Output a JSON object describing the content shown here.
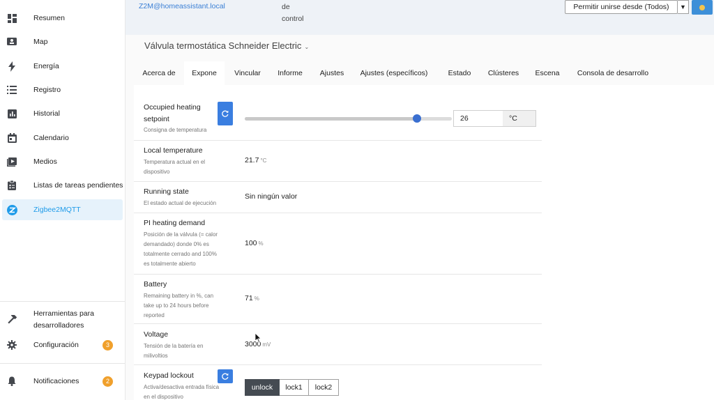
{
  "sidebar": {
    "items": [
      {
        "label": "Resumen",
        "icon": "dashboard-icon"
      },
      {
        "label": "Map",
        "icon": "map-icon"
      },
      {
        "label": "Energía",
        "icon": "lightning-icon"
      },
      {
        "label": "Registro",
        "icon": "list-icon"
      },
      {
        "label": "Historial",
        "icon": "chart-icon"
      },
      {
        "label": "Calendario",
        "icon": "calendar-icon"
      },
      {
        "label": "Medios",
        "icon": "media-icon"
      },
      {
        "label": "Listas de tareas pendientes",
        "icon": "clipboard-icon"
      },
      {
        "label": "Zigbee2MQTT",
        "icon": "zigbee-icon"
      }
    ],
    "bottom": [
      {
        "label1": "Herramientas para",
        "label2": "desarrolladores",
        "icon": "hammer-icon"
      },
      {
        "label": "Configuración",
        "icon": "gear-icon",
        "badge": "3"
      },
      {
        "label": "Notificaciones",
        "icon": "bell-icon",
        "badge": "2"
      }
    ]
  },
  "top": {
    "link": "Z2M@homeassistant.local",
    "ctrl1": "de",
    "ctrl2": "control",
    "permit_label": "Permitir unirse desde (Todos)"
  },
  "device": {
    "title": "Válvula termostática Schneider Electric"
  },
  "tabs": [
    "Acerca de",
    "Expone",
    "Vincular",
    "Informe",
    "Ajustes",
    "Ajustes (específicos)",
    "Estado",
    "Clústeres",
    "Escena",
    "Consola de desarrollo"
  ],
  "exposes": {
    "setpoint": {
      "title1": "Occupied heating",
      "title2": "setpoint",
      "desc": "Consigna de temperatura",
      "value": "26",
      "unit": "°C",
      "slider_fraction": 0.83
    },
    "local_temp": {
      "title": "Local temperature",
      "desc1": "Temperatura actual en el",
      "desc2": "dispositivo",
      "value": "21.7",
      "unit": "°C"
    },
    "running": {
      "title": "Running state",
      "desc": "El estado actual de ejecución",
      "value": "Sin ningún valor"
    },
    "pi_demand": {
      "title": "PI heating demand",
      "desc1": "Posición de la válvula (= calor",
      "desc2": "demandado) donde 0% es",
      "desc3": "totalmente cerrado and 100%",
      "desc4": "es totalmente abierto",
      "value": "100",
      "unit": "%"
    },
    "battery": {
      "title": "Battery",
      "desc1": "Remaining battery in %, can",
      "desc2": "take up to 24 hours before",
      "desc3": "reported",
      "value": "71",
      "unit": "%"
    },
    "voltage": {
      "title": "Voltage",
      "desc1": "Tensión de la batería en",
      "desc2": "milivoltios",
      "value": "3000",
      "unit": "mV"
    },
    "keypad": {
      "title": "Keypad lockout",
      "desc1": "Activa/desactiva entrada física",
      "desc2": "en el dispositivo",
      "options": [
        "unlock",
        "lock1",
        "lock2"
      ],
      "selected": "unlock"
    }
  }
}
